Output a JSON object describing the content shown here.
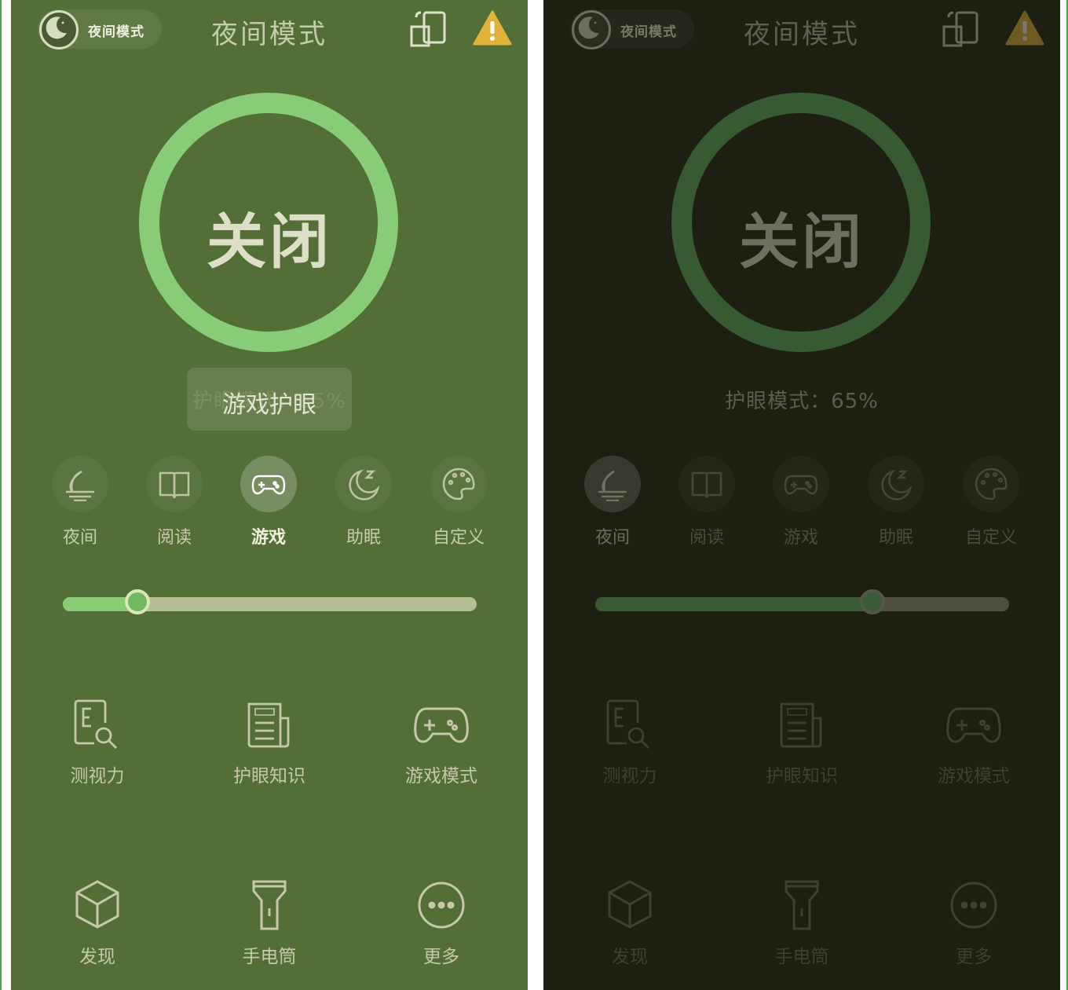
{
  "colors": {
    "left_bg": "#536e36",
    "right_bg": "#1e1f13",
    "accent": "#88cc78",
    "frame": "#54a04a"
  },
  "left": {
    "header": {
      "badge_label": "夜间模式",
      "title": "夜间模式",
      "badge_icon": "moon-icon",
      "rotate_icon": "rotate-screen-icon",
      "warning_icon": "warning-icon"
    },
    "power": {
      "label": "关闭"
    },
    "status": {
      "text": "护眼模式：65%"
    },
    "toast": {
      "text": "游戏护眼"
    },
    "modes": [
      {
        "label": "夜间",
        "icon": "night-icon"
      },
      {
        "label": "阅读",
        "icon": "book-icon"
      },
      {
        "label": "游戏",
        "icon": "gamepad-icon"
      },
      {
        "label": "助眠",
        "icon": "sleep-icon"
      },
      {
        "label": "自定义",
        "icon": "palette-icon"
      }
    ],
    "active_mode": "游戏",
    "slider": {
      "value": 0.18
    },
    "tools": [
      {
        "label": "测视力",
        "icon": "eye-chart-icon"
      },
      {
        "label": "护眼知识",
        "icon": "news-icon"
      },
      {
        "label": "游戏模式",
        "icon": "gamepad-icon"
      },
      {
        "label": "发现",
        "icon": "cube-icon"
      },
      {
        "label": "手电筒",
        "icon": "flashlight-icon"
      },
      {
        "label": "更多",
        "icon": "more-icon"
      }
    ]
  },
  "right": {
    "header": {
      "badge_label": "夜间模式",
      "title": "夜间模式",
      "badge_icon": "moon-icon",
      "rotate_icon": "rotate-screen-icon",
      "warning_icon": "warning-icon"
    },
    "power": {
      "label": "关闭"
    },
    "status": {
      "text": "护眼模式：65%"
    },
    "modes": [
      {
        "label": "夜间",
        "icon": "night-icon"
      },
      {
        "label": "阅读",
        "icon": "book-icon"
      },
      {
        "label": "游戏",
        "icon": "gamepad-icon"
      },
      {
        "label": "助眠",
        "icon": "sleep-icon"
      },
      {
        "label": "自定义",
        "icon": "palette-icon"
      }
    ],
    "active_mode": "夜间",
    "slider": {
      "value": 0.67
    },
    "tools": [
      {
        "label": "测视力",
        "icon": "eye-chart-icon"
      },
      {
        "label": "护眼知识",
        "icon": "news-icon"
      },
      {
        "label": "游戏模式",
        "icon": "gamepad-icon"
      },
      {
        "label": "发现",
        "icon": "cube-icon"
      },
      {
        "label": "手电筒",
        "icon": "flashlight-icon"
      },
      {
        "label": "更多",
        "icon": "more-icon"
      }
    ]
  }
}
